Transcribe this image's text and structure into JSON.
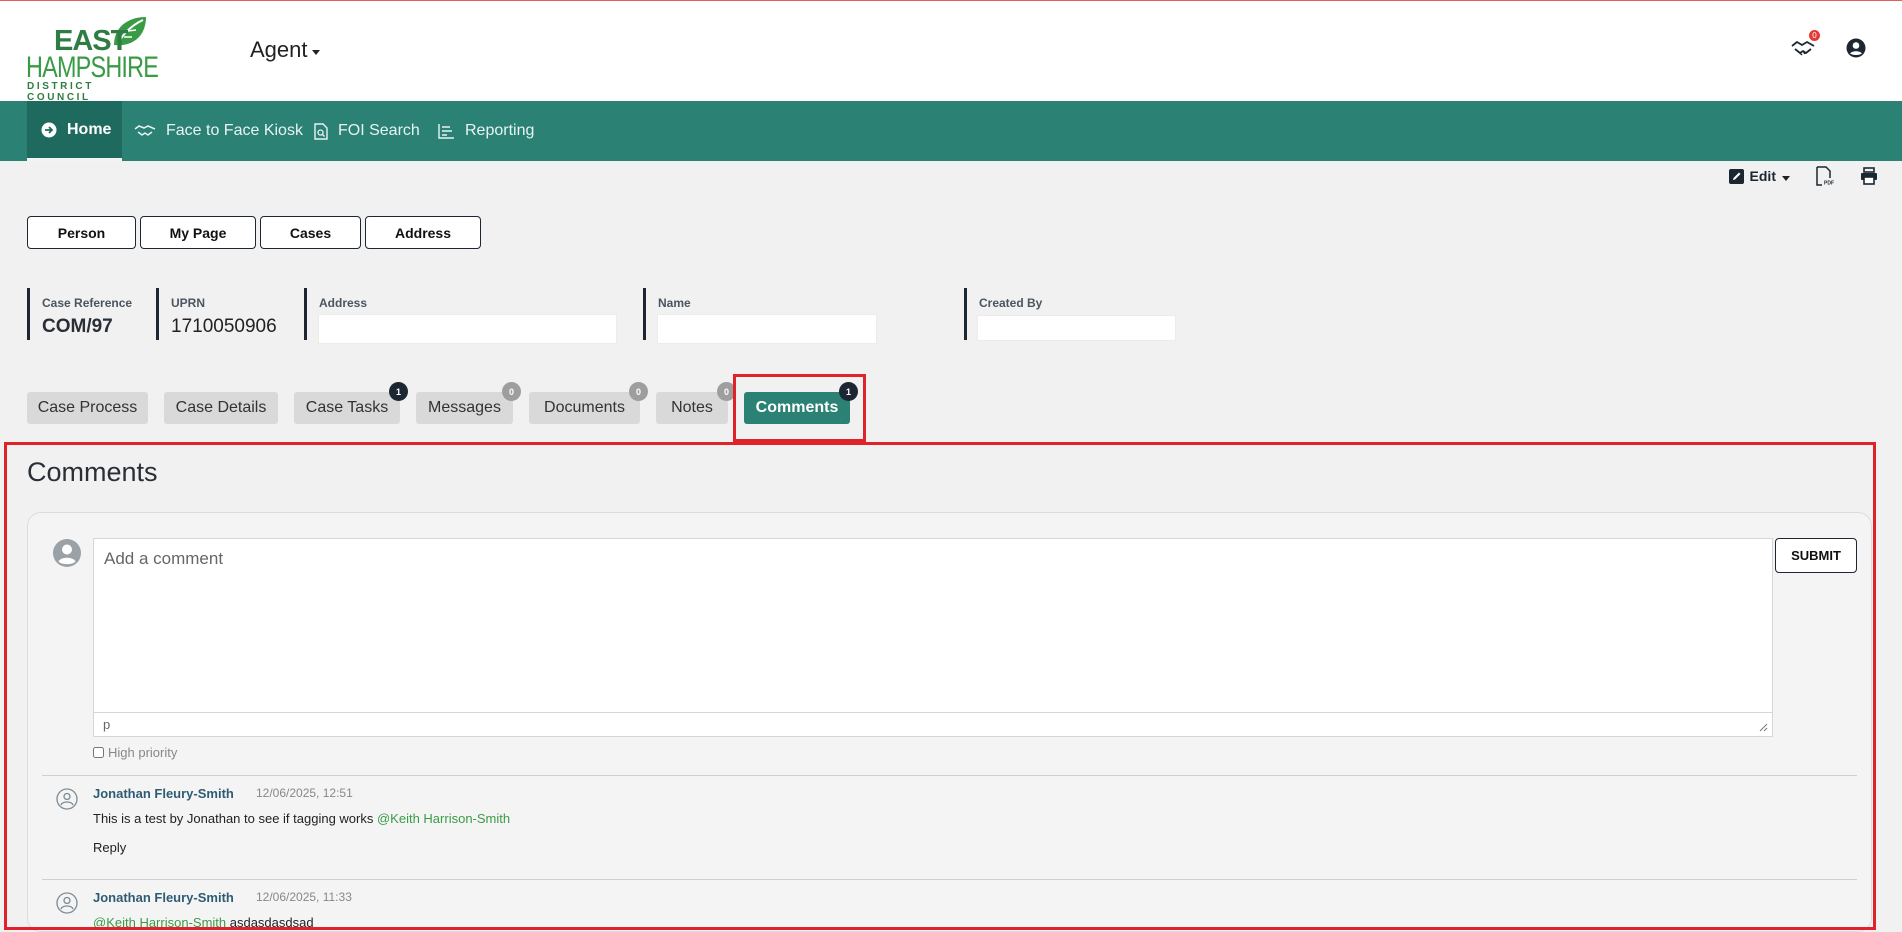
{
  "logo": {
    "line1": "EAST",
    "line2": "HAMPSHIRE",
    "line3": "DISTRICT COUNCIL"
  },
  "header": {
    "agent_label": "Agent",
    "notification_count": "0"
  },
  "nav": {
    "items": [
      {
        "label": "Home",
        "icon": "arrow-circle-right-icon",
        "active": true
      },
      {
        "label": "Face to Face Kiosk",
        "icon": "handshake-icon"
      },
      {
        "label": "FOI Search",
        "icon": "document-search-icon"
      },
      {
        "label": "Reporting",
        "icon": "chart-lines-icon"
      }
    ]
  },
  "toolbar": {
    "edit_label": "Edit",
    "pdf_icon": "pdf-icon",
    "print_icon": "print-icon"
  },
  "quick_buttons": [
    "Person",
    "My Page",
    "Cases",
    "Address"
  ],
  "case_info": {
    "case_reference": {
      "label": "Case Reference",
      "value": "COM/97"
    },
    "uprn": {
      "label": "UPRN",
      "value": "1710050906"
    },
    "address": {
      "label": "Address",
      "value": ""
    },
    "name": {
      "label": "Name",
      "value": ""
    },
    "created_by": {
      "label": "Created By",
      "value": ""
    }
  },
  "tabs": [
    {
      "label": "Case Process"
    },
    {
      "label": "Case Details"
    },
    {
      "label": "Case Tasks",
      "badge": "1"
    },
    {
      "label": "Messages",
      "badge": "0"
    },
    {
      "label": "Documents",
      "badge": "0"
    },
    {
      "label": "Notes",
      "badge": "0"
    },
    {
      "label": "Comments",
      "badge": "1",
      "active": true
    }
  ],
  "comments": {
    "title": "Comments",
    "input_placeholder": "Add a comment",
    "editor_path": "p",
    "submit_label": "SUBMIT",
    "high_priority_label": "High priority",
    "items": [
      {
        "author": "Jonathan Fleury-Smith",
        "time": "12/06/2025, 12:51",
        "text": "This is a test by Jonathan to see if tagging works ",
        "mention": "@Keith Harrison-Smith",
        "reply_label": "Reply"
      },
      {
        "author": "Jonathan Fleury-Smith",
        "time": "12/06/2025, 11:33",
        "mention": "@Keith Harrison-Smith",
        "text": " asdasdasdsad"
      }
    ]
  },
  "colors": {
    "nav_bg": "#2b8173",
    "nav_active": "#1f6a5e",
    "highlight": "#e0232a",
    "brand_green": "#3a9b47"
  }
}
